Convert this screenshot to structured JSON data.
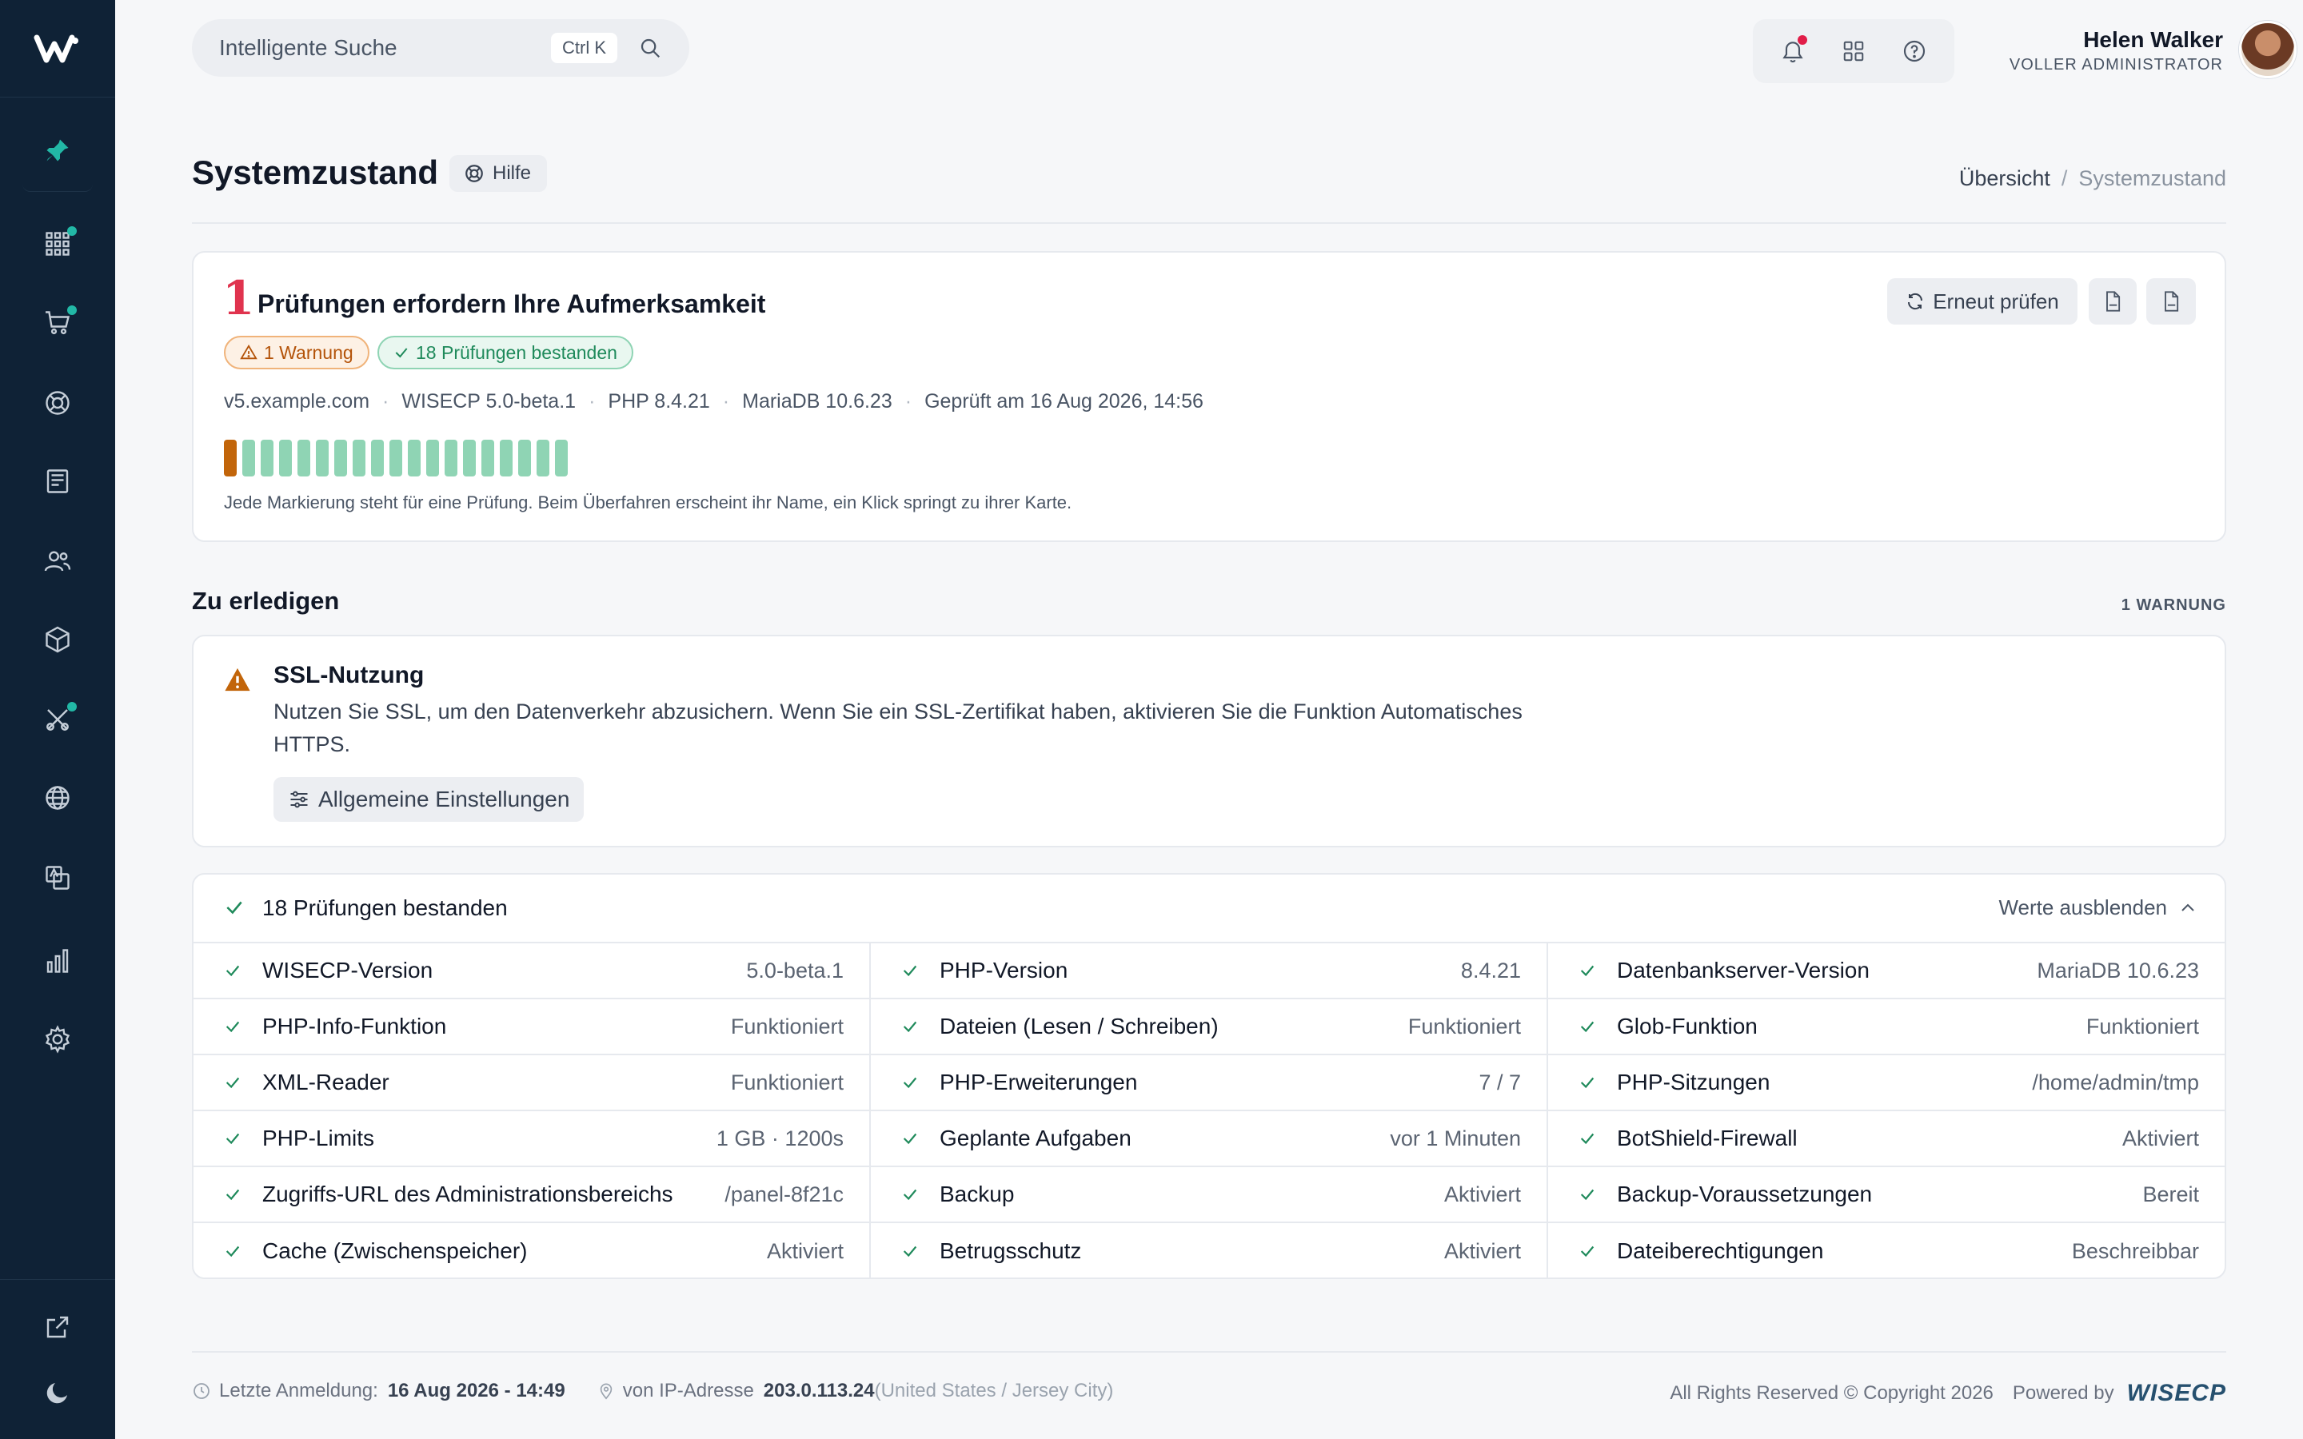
{
  "topbar": {
    "search_label": "Intelligente Suche",
    "search_shortcut": "Ctrl K"
  },
  "user": {
    "name": "Helen Walker",
    "role": "VOLLER ADMINISTRATOR"
  },
  "page": {
    "title": "Systemzustand",
    "help_label": "Hilfe",
    "breadcrumb": [
      "Übersicht",
      "Systemzustand"
    ]
  },
  "summary": {
    "count": "1",
    "title": "Prüfungen erfordern Ihre Aufmerksamkeit",
    "warn_pill": "1 Warnung",
    "ok_pill": "18 Prüfungen bestanden",
    "meta": [
      "v5.example.com",
      "WISECP 5.0-beta.1",
      "PHP 8.4.21",
      "MariaDB 10.6.23",
      "Geprüft am 16 Aug 2026, 14:56"
    ],
    "legend": "Jede Markierung steht für eine Prüfung. Beim Überfahren erscheint ihr Name, ein Klick springt zu ihrer Karte.",
    "recheck_label": "Erneut prüfen",
    "ticks": [
      "warn",
      "ok",
      "ok",
      "ok",
      "ok",
      "ok",
      "ok",
      "ok",
      "ok",
      "ok",
      "ok",
      "ok",
      "ok",
      "ok",
      "ok",
      "ok",
      "ok",
      "ok",
      "ok"
    ]
  },
  "todo": {
    "section_title": "Zu erledigen",
    "section_count": "1 WARNUNG",
    "title": "SSL-Nutzung",
    "description": "Nutzen Sie SSL, um den Datenverkehr abzusichern. Wenn Sie ein SSL-Zertifikat haben, aktivieren Sie die Funktion Automatisches HTTPS.",
    "button_label": "Allgemeine Einstellungen"
  },
  "passed": {
    "title": "18 Prüfungen bestanden",
    "toggle_label": "Werte ausblenden",
    "checks": [
      {
        "name": "WISECP-Version",
        "value": "5.0-beta.1"
      },
      {
        "name": "PHP-Version",
        "value": "8.4.21"
      },
      {
        "name": "Datenbankserver-Version",
        "value": "MariaDB 10.6.23"
      },
      {
        "name": "PHP-Info-Funktion",
        "value": "Funktioniert"
      },
      {
        "name": "Dateien (Lesen / Schreiben)",
        "value": "Funktioniert"
      },
      {
        "name": "Glob-Funktion",
        "value": "Funktioniert"
      },
      {
        "name": "XML-Reader",
        "value": "Funktioniert"
      },
      {
        "name": "PHP-Erweiterungen",
        "value": "7 / 7"
      },
      {
        "name": "PHP-Sitzungen",
        "value": "/home/admin/tmp"
      },
      {
        "name": "PHP-Limits",
        "value": "1 GB · 1200s"
      },
      {
        "name": "Geplante Aufgaben",
        "value": "vor 1 Minuten"
      },
      {
        "name": "BotShield-Firewall",
        "value": "Aktiviert"
      },
      {
        "name": "Zugriffs-URL des Administrationsbereichs",
        "value": "/panel-8f21c"
      },
      {
        "name": "Backup",
        "value": "Aktiviert"
      },
      {
        "name": "Backup-Voraussetzungen",
        "value": "Bereit"
      },
      {
        "name": "Cache (Zwischenspeicher)",
        "value": "Aktiviert"
      },
      {
        "name": "Betrugsschutz",
        "value": "Aktiviert"
      },
      {
        "name": "Dateiberechtigungen",
        "value": "Beschreibbar"
      }
    ]
  },
  "footer": {
    "last_login_label": "Letzte Anmeldung:",
    "last_login_value": "16 Aug 2026 - 14:49",
    "ip_label": "von IP-Adresse",
    "ip_value": "203.0.113.24",
    "ip_location": "(United States / Jersey City)",
    "copyright": "All Rights Reserved © Copyright 2026",
    "powered_by": "Powered by",
    "brand": "WISECP"
  },
  "colors": {
    "sidebar": "#0f2236",
    "accent_ok": "#1f8a5b",
    "accent_warn": "#c2650a",
    "alert_red": "#e0334e"
  },
  "sidebar_icons": [
    "pin-icon",
    "grid-icon",
    "cart-icon",
    "lifebuoy-icon",
    "invoice-icon",
    "users-icon",
    "package-icon",
    "tools-icon",
    "globe-icon",
    "translate-icon",
    "chart-icon",
    "gear-icon",
    "external-link-icon",
    "moon-icon"
  ]
}
